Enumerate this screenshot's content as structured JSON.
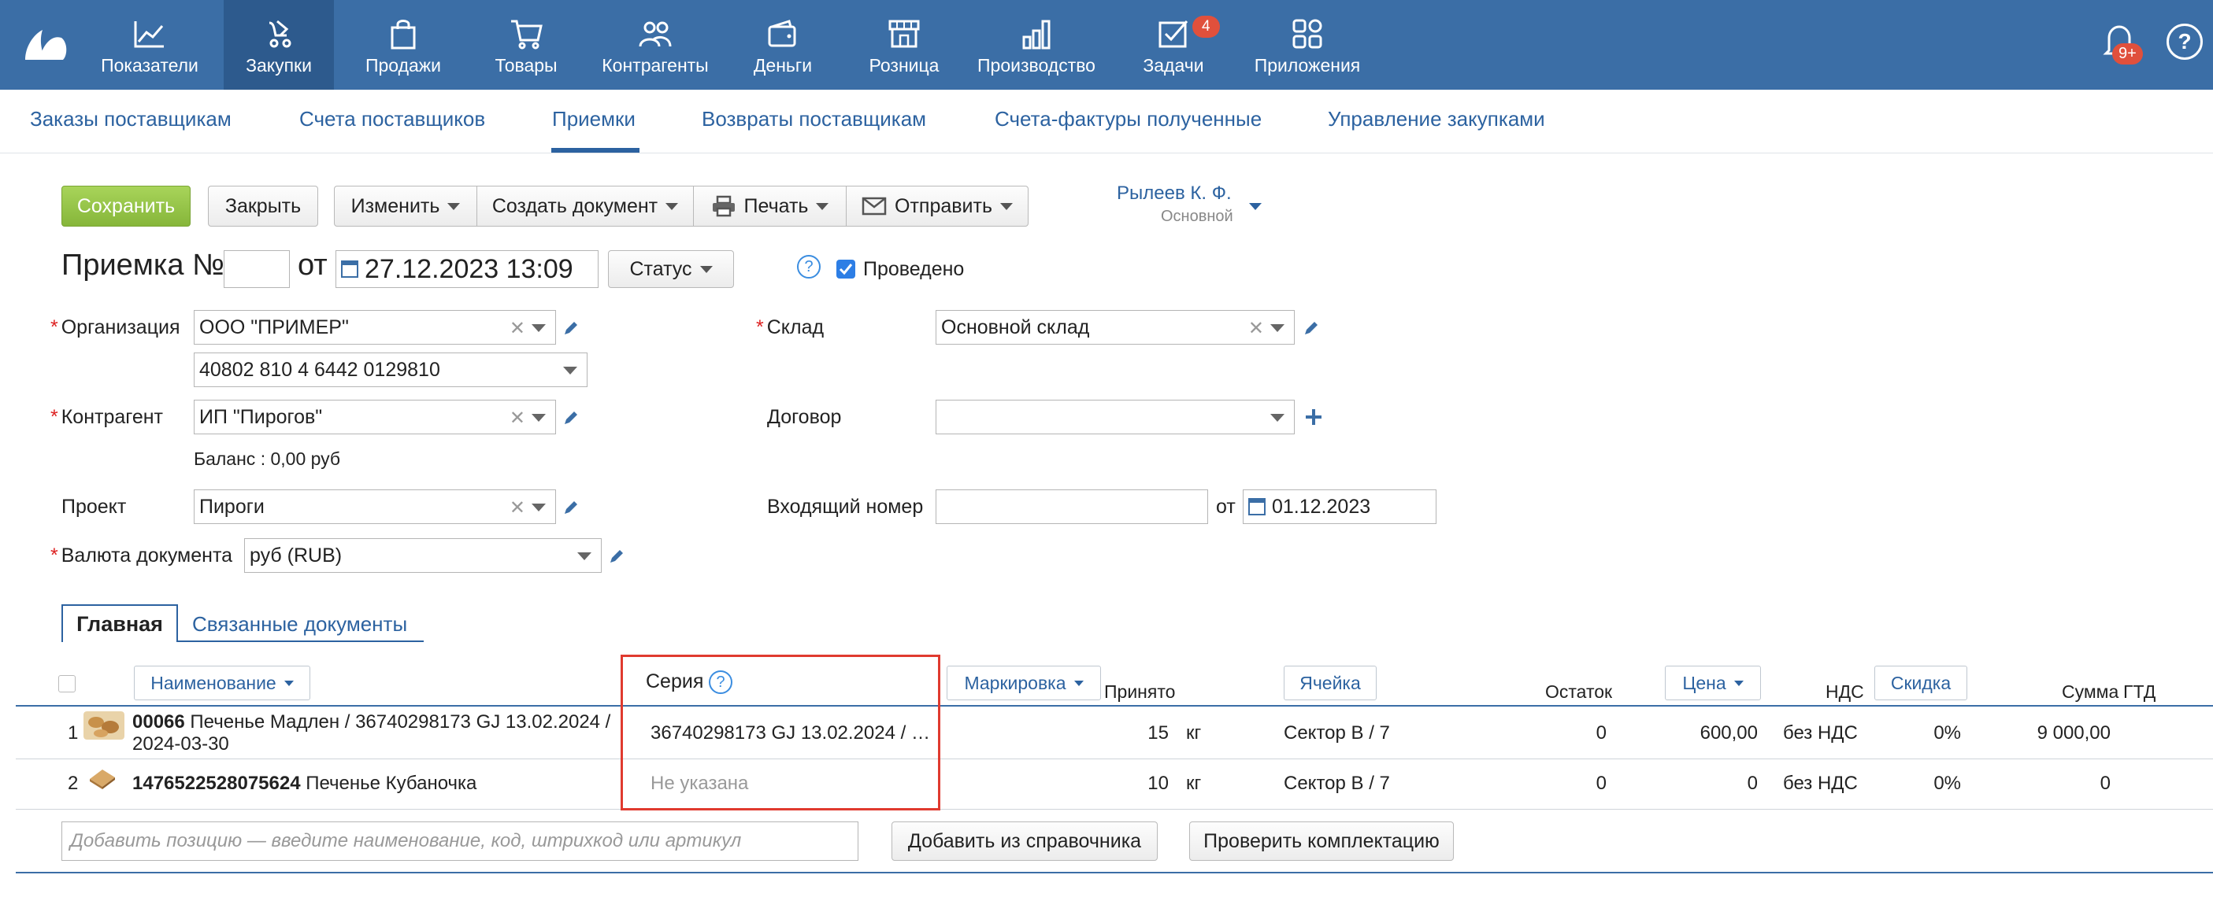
{
  "nav": {
    "items": [
      {
        "label": "Показатели",
        "icon": "chart-icon"
      },
      {
        "label": "Закупки",
        "icon": "purchases-icon",
        "active": true
      },
      {
        "label": "Продажи",
        "icon": "bag-icon"
      },
      {
        "label": "Товары",
        "icon": "cart-icon"
      },
      {
        "label": "Контрагенты",
        "icon": "people-icon"
      },
      {
        "label": "Деньги",
        "icon": "wallet-icon"
      },
      {
        "label": "Розница",
        "icon": "store-icon"
      },
      {
        "label": "Производство",
        "icon": "factory-icon"
      },
      {
        "label": "Задачи",
        "icon": "tasks-icon",
        "badge": "4"
      },
      {
        "label": "Приложения",
        "icon": "apps-icon"
      }
    ],
    "notifications_badge": "9+",
    "help": "?"
  },
  "subnav": {
    "items": [
      "Заказы поставщикам",
      "Счета поставщиков",
      "Приемки",
      "Возвраты поставщикам",
      "Счета-фактуры полученные",
      "Управление закупками"
    ],
    "active": "Приемки"
  },
  "toolbar": {
    "save": "Сохранить",
    "close": "Закрыть",
    "edit": "Изменить",
    "create_doc": "Создать документ",
    "print": "Печать",
    "send": "Отправить"
  },
  "user": {
    "name": "Рылеев К. Ф.",
    "role": "Основной"
  },
  "doc": {
    "title": "Приемка №",
    "number": "",
    "from_label": "от",
    "datetime": "27.12.2023 13:09",
    "status": "Статус",
    "help": "?",
    "posted_label": "Проведено",
    "posted": true
  },
  "form": {
    "org_label": "Организация",
    "org_value": "ООО \"ПРИМЕР\"",
    "account_value": "40802 810 4 6442 0129810",
    "counterparty_label": "Контрагент",
    "counterparty_value": "ИП \"Пирогов\"",
    "balance": "Баланс : 0,00 руб",
    "project_label": "Проект",
    "project_value": "Пироги",
    "currency_label": "Валюта документа",
    "currency_value": "руб (RUB)",
    "warehouse_label": "Склад",
    "warehouse_value": "Основной склад",
    "contract_label": "Договор",
    "contract_value": "",
    "incoming_label": "Входящий номер",
    "incoming_value": "",
    "incoming_from": "от",
    "incoming_date": "01.12.2023"
  },
  "tabs": {
    "main": "Главная",
    "related": "Связанные документы"
  },
  "table": {
    "headers": {
      "name": "Наименование",
      "series": "Серия",
      "marking": "Маркировка",
      "accepted": "Принято",
      "cell": "Ячейка",
      "remainder": "Остаток",
      "price": "Цена",
      "vat": "НДС",
      "discount": "Скидка",
      "sum": "Сумма",
      "gtd": "ГТД"
    },
    "rows": [
      {
        "num": "1",
        "code": "00066",
        "name_line1": "Печенье Мадлен / 36740298173 GJ 13.02.2024 /",
        "name_line2": "2024-03-30",
        "series": "36740298173 GJ 13.02.2024 / …",
        "accepted": "15",
        "unit": "кг",
        "cell": "Сектор В / 7",
        "remainder": "0",
        "price": "600,00",
        "vat": "без НДС",
        "discount": "0%",
        "sum": "9 000,00"
      },
      {
        "num": "2",
        "code": "1476522528075624",
        "name_line1": "Печенье Кубаночка",
        "name_line2": "",
        "series": "Не указана",
        "accepted": "10",
        "unit": "кг",
        "cell": "Сектор В / 7",
        "remainder": "0",
        "price": "0",
        "vat": "без НДС",
        "discount": "0%",
        "sum": "0"
      }
    ]
  },
  "footer": {
    "add_placeholder": "Добавить позицию — введите наименование, код, штрихкод или артикул",
    "add_from_catalog": "Добавить из справочника",
    "check_kit": "Проверить комплектацию"
  }
}
